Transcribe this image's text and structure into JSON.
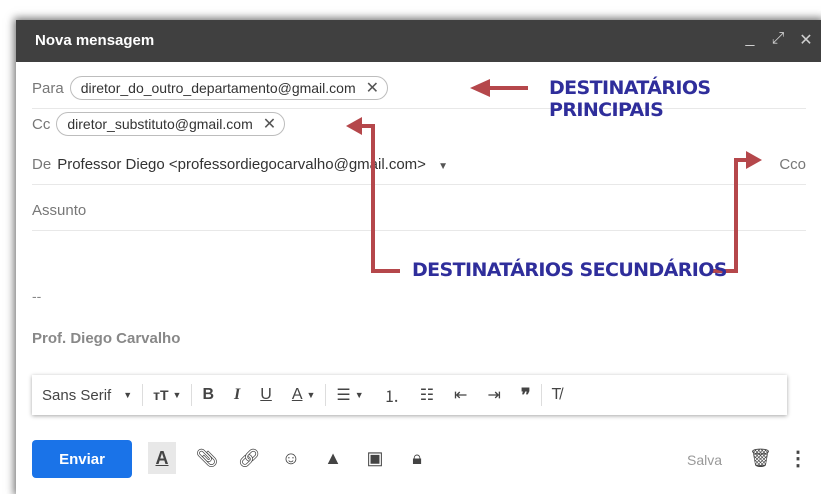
{
  "window": {
    "title": "Nova mensagem",
    "controls": [
      "_",
      "⤢",
      "✕"
    ]
  },
  "to": {
    "label": "Para",
    "chip": "diretor_do_outro_departamento@gmail.com"
  },
  "cc": {
    "label": "Cc",
    "chip": "diretor_substituto@gmail.com"
  },
  "from": {
    "label": "De",
    "value": "Professor Diego <professordiegocarvalho@gmail.com>",
    "bcc": "Cco"
  },
  "subject": {
    "placeholder": "Assunto"
  },
  "body": {
    "dashes": "--",
    "signature": "Prof. Diego Carvalho"
  },
  "callouts": {
    "primary": "DESTINATÁRIOS PRINCIPAIS",
    "secondary": "DESTINATÁRIOS SECUNDÁRIOS"
  },
  "format_bar": {
    "font": "Sans Serif"
  },
  "footer": {
    "send": "Enviar",
    "saved": "Salva"
  },
  "colors": {
    "accent": "#1a73e8",
    "callout": "#2f2e9b",
    "arrow": "#b5474b",
    "titlebar": "#404040"
  }
}
